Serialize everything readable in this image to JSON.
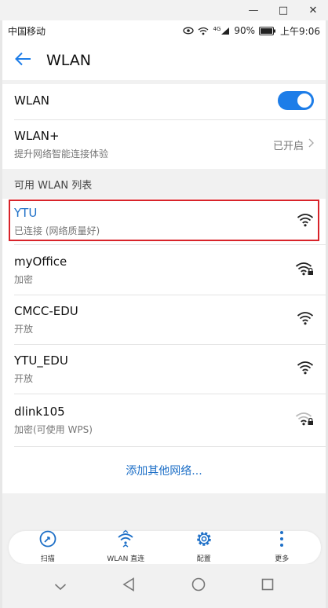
{
  "window": {
    "minimize": "—",
    "maximize": "□",
    "close": "✕"
  },
  "status_bar": {
    "carrier": "中国移动",
    "network": "4G",
    "battery": "90%",
    "time": "上午9:06"
  },
  "toolbar": {
    "title": "WLAN",
    "back_icon": "back-arrow-icon"
  },
  "wlan_toggle": {
    "label": "WLAN",
    "on": true
  },
  "wlan_plus": {
    "label": "WLAN+",
    "description": "提升网络智能连接体验",
    "status": "已开启"
  },
  "list_header": "可用 WLAN 列表",
  "networks": [
    {
      "ssid": "YTU",
      "status": "已连接 (网络质量好)",
      "locked": false,
      "connected": true
    },
    {
      "ssid": "myOffice",
      "status": "加密",
      "locked": true,
      "connected": false
    },
    {
      "ssid": "CMCC-EDU",
      "status": "开放",
      "locked": false,
      "connected": false
    },
    {
      "ssid": "YTU_EDU",
      "status": "开放",
      "locked": false,
      "connected": false
    },
    {
      "ssid": "dlink105",
      "status": "加密(可使用 WPS)",
      "locked": true,
      "connected": false
    }
  ],
  "add_network": "添加其他网络...",
  "bottom_bar": [
    {
      "label": "扫描",
      "icon": "scan-icon"
    },
    {
      "label": "WLAN 直连",
      "icon": "wifi-direct-icon"
    },
    {
      "label": "配置",
      "icon": "gear-icon"
    },
    {
      "label": "更多",
      "icon": "more-icon"
    }
  ],
  "colors": {
    "accent": "#1d7de8",
    "link": "#1d6fc7",
    "highlight": "#d8232a"
  }
}
